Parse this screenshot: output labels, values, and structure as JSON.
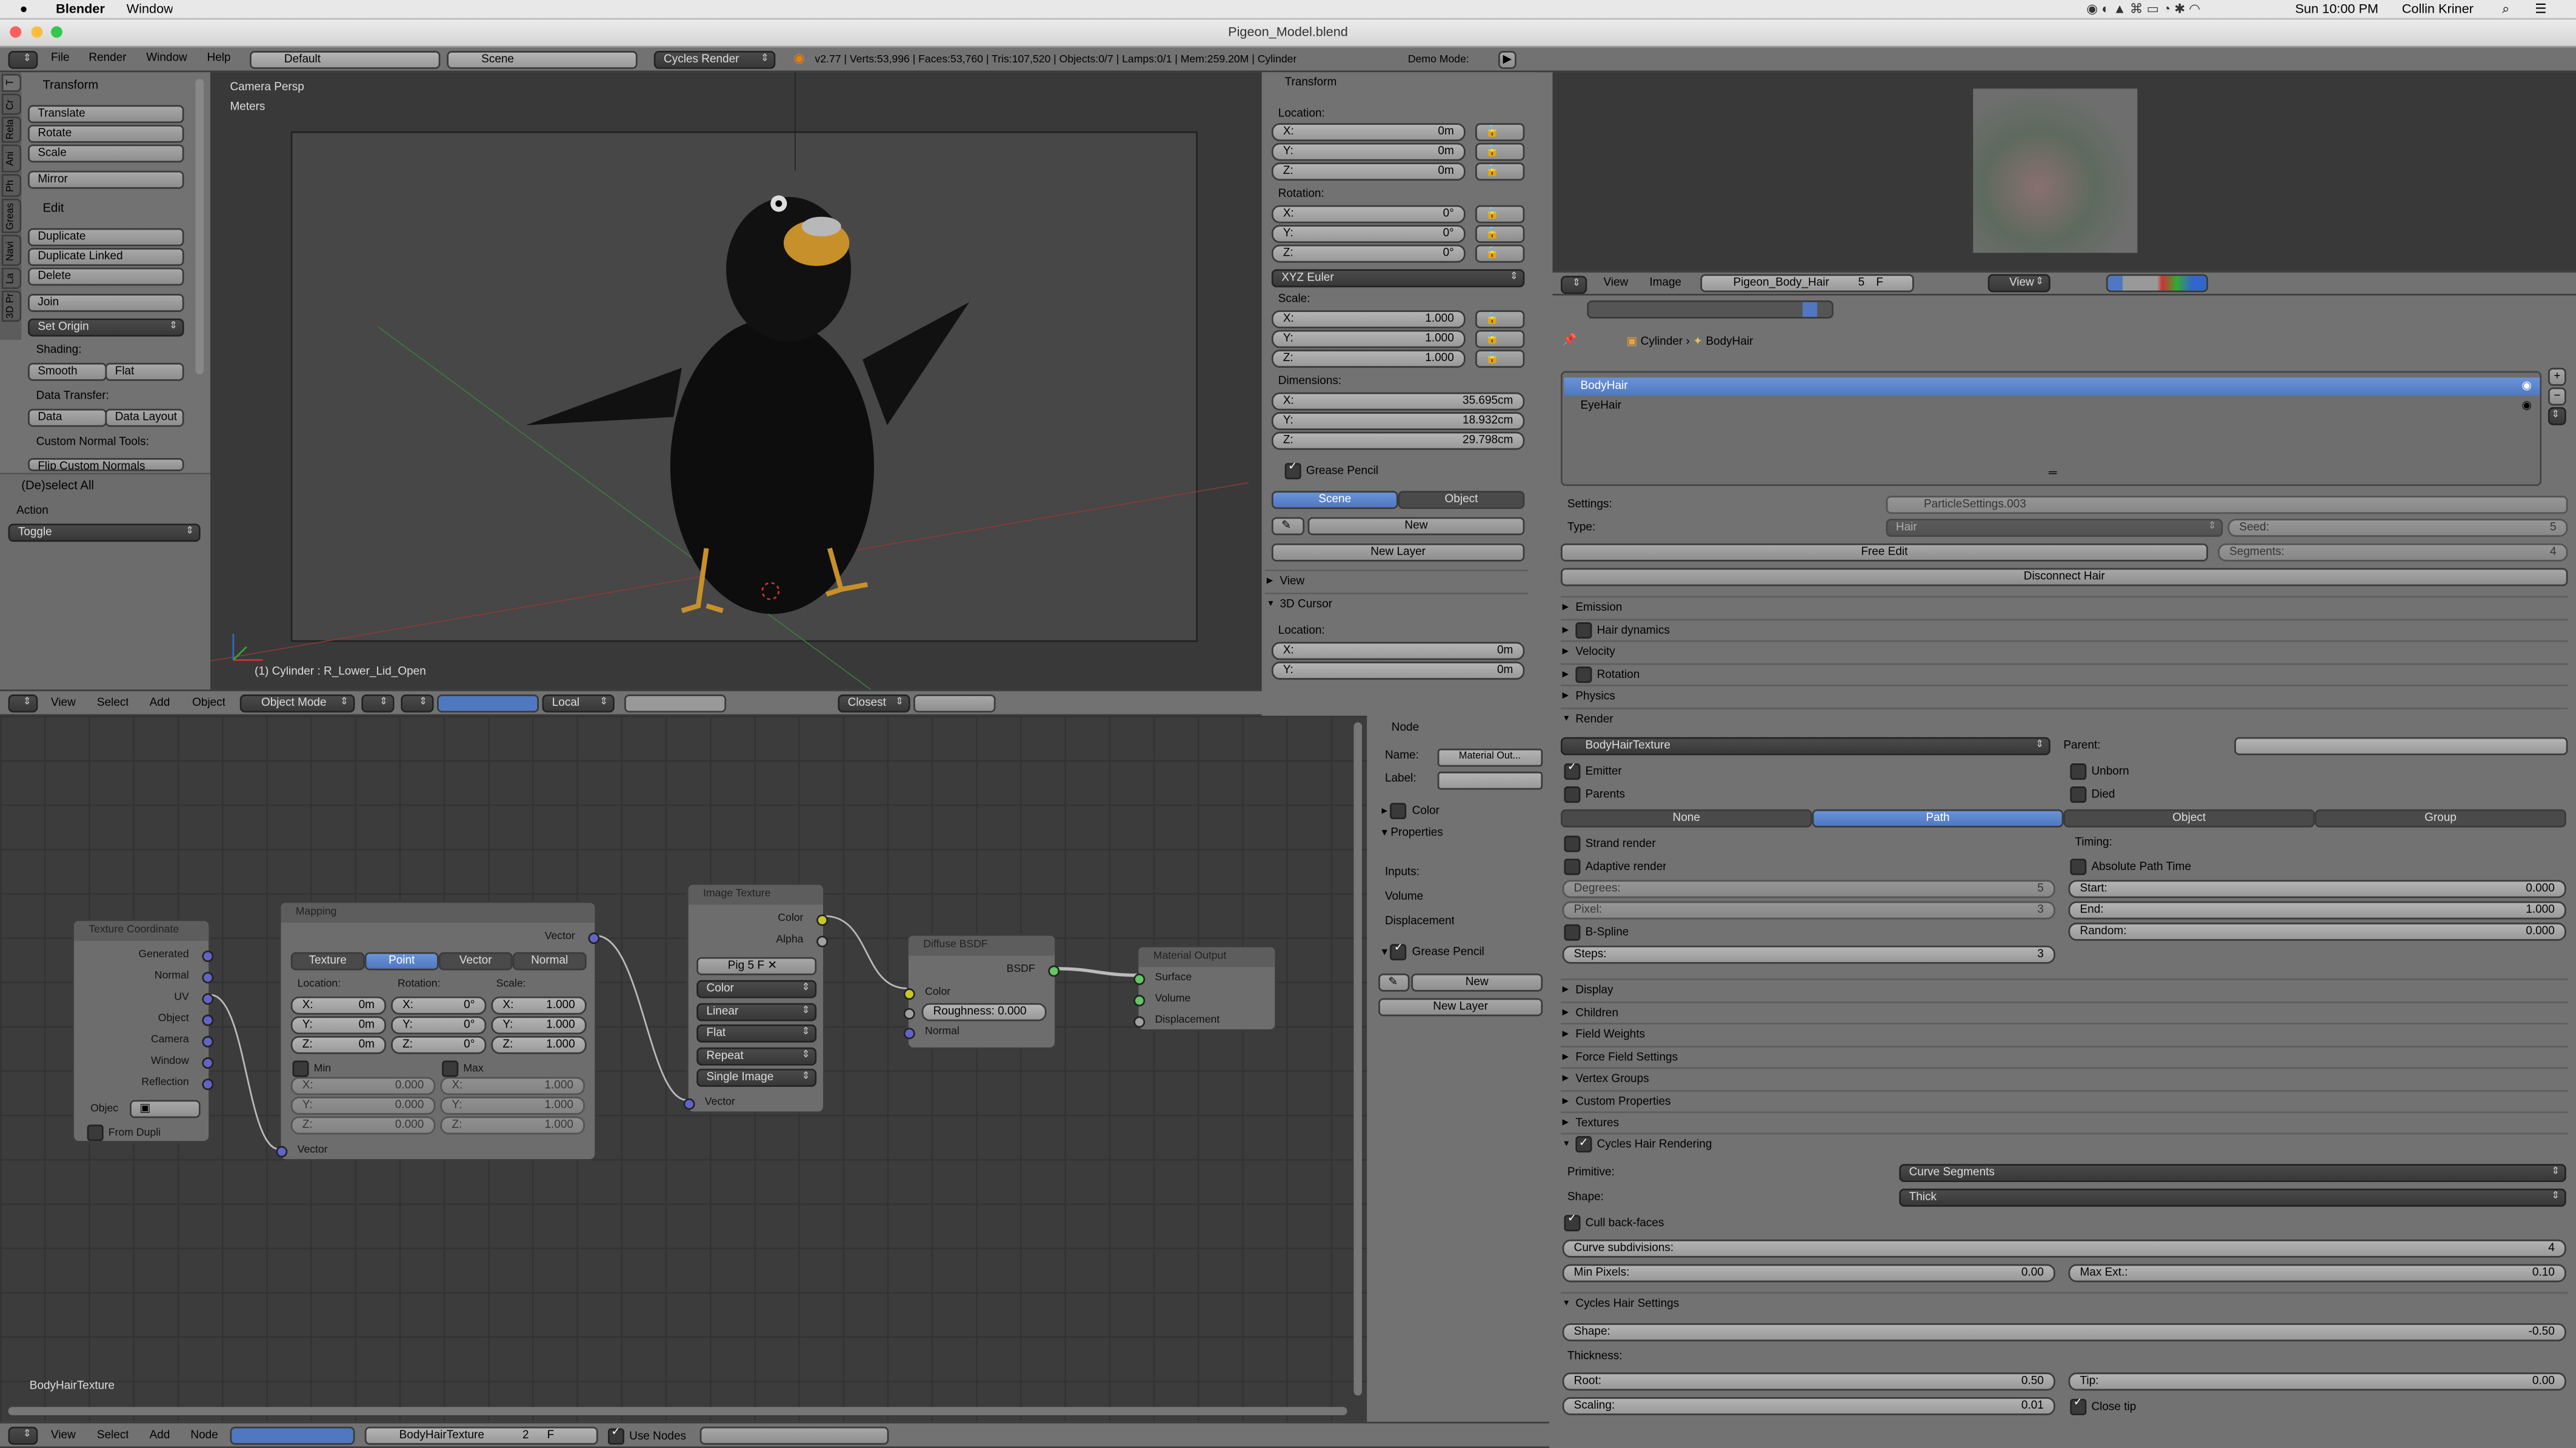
{
  "mac_menu": {
    "apple": "",
    "app": "Blender",
    "window": "Window",
    "clock": "Sun 10:00 PM",
    "user": "Collin Kriner"
  },
  "window_title": "Pigeon_Model.blend",
  "info": {
    "menus": [
      "File",
      "Render",
      "Window",
      "Help"
    ],
    "layout": "Default",
    "scene": "Scene",
    "engine": "Cycles Render",
    "stats": "v2.77 | Verts:53,996 | Faces:53,760 | Tris:107,520 | Objects:0/7 | Lamps:0/1 | Mem:259.20M | Cylinder",
    "demo": "Demo Mode:"
  },
  "toolshelf": {
    "tabs": [
      "T",
      "Cr",
      "Rela",
      "Ani",
      "Ph",
      "Greas",
      "Navi",
      "La",
      "3D Pr"
    ],
    "transform_title": "Transform",
    "translate": "Translate",
    "rotate": "Rotate",
    "scale": "Scale",
    "mirror": "Mirror",
    "edit_title": "Edit",
    "duplicate": "Duplicate",
    "duplicate_linked": "Duplicate Linked",
    "delete": "Delete",
    "join": "Join",
    "set_origin": "Set Origin",
    "shading": "Shading:",
    "smooth": "Smooth",
    "flat": "Flat",
    "data_transfer": "Data Transfer:",
    "data": "Data",
    "data_layout": "Data Layout",
    "custom_normal": "Custom Normal Tools:",
    "flip": "Flip Custom Normals",
    "operator_title": "(De)select All",
    "action": "Action",
    "action_value": "Toggle"
  },
  "viewport": {
    "view_name": "Camera Persp",
    "units": "Meters",
    "object_info": "(1) Cylinder : R_Lower_Lid_Open",
    "header": {
      "menus": [
        "View",
        "Select",
        "Add",
        "Object"
      ],
      "mode": "Object Mode",
      "orientation": "Local",
      "snap": "Closest"
    }
  },
  "npanel": {
    "transform": "Transform",
    "location": "Location:",
    "loc": [
      "0m",
      "0m",
      "0m"
    ],
    "rotation": "Rotation:",
    "rot": [
      "0°",
      "0°",
      "0°"
    ],
    "rotation_mode": "XYZ Euler",
    "scale": "Scale:",
    "scl": [
      "1.000",
      "1.000",
      "1.000"
    ],
    "dimensions": "Dimensions:",
    "dim": [
      "35.695cm",
      "18.932cm",
      "29.798cm"
    ],
    "axes": [
      "X:",
      "Y:",
      "Z:"
    ],
    "grease_pencil": "Grease Pencil",
    "scene": "Scene",
    "object": "Object",
    "new": "New",
    "new_layer": "New Layer",
    "view": "View",
    "cursor": "3D Cursor",
    "cursor_location": "Location:",
    "cur": [
      "0m",
      "0m"
    ]
  },
  "image_editor": {
    "menus": [
      "View",
      "Image"
    ],
    "image": "Pigeon_Body_Hair",
    "users": "5",
    "fake": "F",
    "view": "View"
  },
  "properties": {
    "breadcrumb": [
      "Cylinder",
      "BodyHair"
    ],
    "systems": [
      {
        "name": "BodyHair",
        "selected": true
      },
      {
        "name": "EyeHair",
        "selected": false
      }
    ],
    "settings_label": "Settings:",
    "settings_value": "ParticleSettings.003",
    "type_label": "Type:",
    "type_value": "Hair",
    "seed": "Seed:",
    "seed_value": "5",
    "free_edit": "Free Edit",
    "segments": "Segments:",
    "segments_value": "4",
    "disconnect": "Disconnect Hair",
    "collapsed1": [
      "Emission",
      "Hair dynamics",
      "Velocity",
      "Rotation",
      "Physics"
    ],
    "render": {
      "title": "Render",
      "material": "BodyHairTexture",
      "parent": "Parent:",
      "emitter": "Emitter",
      "unborn": "Unborn",
      "parents": "Parents",
      "died": "Died",
      "modes": [
        "None",
        "Path",
        "Object",
        "Group"
      ],
      "active_mode": "Path",
      "strand": "Strand render",
      "timing": "Timing:",
      "adaptive": "Adaptive render",
      "absolute": "Absolute Path Time",
      "degrees": "Degrees:",
      "degrees_v": "5",
      "start": "Start:",
      "start_v": "0.000",
      "pixel": "Pixel:",
      "pixel_v": "3",
      "end": "End:",
      "end_v": "1.000",
      "bspline": "B-Spline",
      "random": "Random:",
      "random_v": "0.000",
      "steps": "Steps:",
      "steps_v": "3"
    },
    "collapsed2": [
      "Display",
      "Children",
      "Field Weights",
      "Force Field Settings",
      "Vertex Groups",
      "Custom Properties",
      "Textures"
    ],
    "cycles_render": {
      "title": "Cycles Hair Rendering",
      "primitive": "Primitive:",
      "primitive_v": "Curve Segments",
      "shape": "Shape:",
      "shape_v": "Thick",
      "cull": "Cull back-faces",
      "subdiv": "Curve subdivisions:",
      "subdiv_v": "4",
      "minpx": "Min Pixels:",
      "minpx_v": "0.00",
      "maxext": "Max Ext.:",
      "maxext_v": "0.10"
    },
    "cycles_settings": {
      "title": "Cycles Hair Settings",
      "shape": "Shape:",
      "shape_v": "-0.50",
      "thickness": "Thickness:",
      "root": "Root:",
      "root_v": "0.50",
      "tip": "Tip:",
      "tip_v": "0.00",
      "scaling": "Scaling:",
      "scaling_v": "0.01",
      "close_tip": "Close tip"
    }
  },
  "nodes": {
    "texcoord": {
      "title": "Texture Coordinate",
      "outputs": [
        "Generated",
        "Normal",
        "UV",
        "Object",
        "Camera",
        "Window",
        "Reflection"
      ],
      "object": "Objec",
      "from_dupli": "From Dupli"
    },
    "mapping": {
      "title": "Mapping",
      "out": "Vector",
      "tabs": [
        "Texture",
        "Point",
        "Vector",
        "Normal"
      ],
      "active": "Point",
      "location": "Location:",
      "rotation": "Rotation:",
      "scale": "Scale:",
      "loc": [
        "0m",
        "0m",
        "0m"
      ],
      "rot": [
        "0°",
        "0°",
        "0°"
      ],
      "scl": [
        "1.000",
        "1.000",
        "1.000"
      ],
      "min": "Min",
      "max": "Max",
      "minv": [
        "0.000",
        "0.000",
        "0.000"
      ],
      "maxv": [
        "1.000",
        "1.000",
        "1.000"
      ],
      "in": "Vector"
    },
    "image": {
      "title": "Image Texture",
      "color": "Color",
      "alpha": "Alpha",
      "img": "Pig",
      "users": "5",
      "fake": "F",
      "opts": [
        "Color",
        "Linear",
        "Flat",
        "Repeat",
        "Single Image"
      ],
      "in": "Vector"
    },
    "diffuse": {
      "title": "Diffuse BSDF",
      "out": "BSDF",
      "color": "Color",
      "roughness": "Roughness:",
      "roughness_v": "0.000",
      "normal": "Normal"
    },
    "output": {
      "title": "Material Output",
      "surface": "Surface",
      "volume": "Volume",
      "displacement": "Displacement"
    },
    "material_name": "BodyHairTexture"
  },
  "node_npanel": {
    "node": "Node",
    "name": "Name:",
    "name_v": "Material Out...",
    "label": "Label:",
    "color": "Color",
    "properties": "Properties",
    "inputs": "Inputs:",
    "volume": "Volume",
    "displacement": "Displacement",
    "grease": "Grease Pencil",
    "new": "New",
    "new_layer": "New Layer"
  },
  "node_header": {
    "menus": [
      "View",
      "Select",
      "Add",
      "Node"
    ],
    "material": "BodyHairTexture",
    "users": "2",
    "fake": "F",
    "use_nodes": "Use Nodes"
  },
  "colors": {
    "accent": "#5680c2",
    "socket_vector": "#6363c7",
    "socket_color": "#c7c729",
    "socket_shader": "#63c763",
    "socket_gray": "#a1a1a1"
  }
}
